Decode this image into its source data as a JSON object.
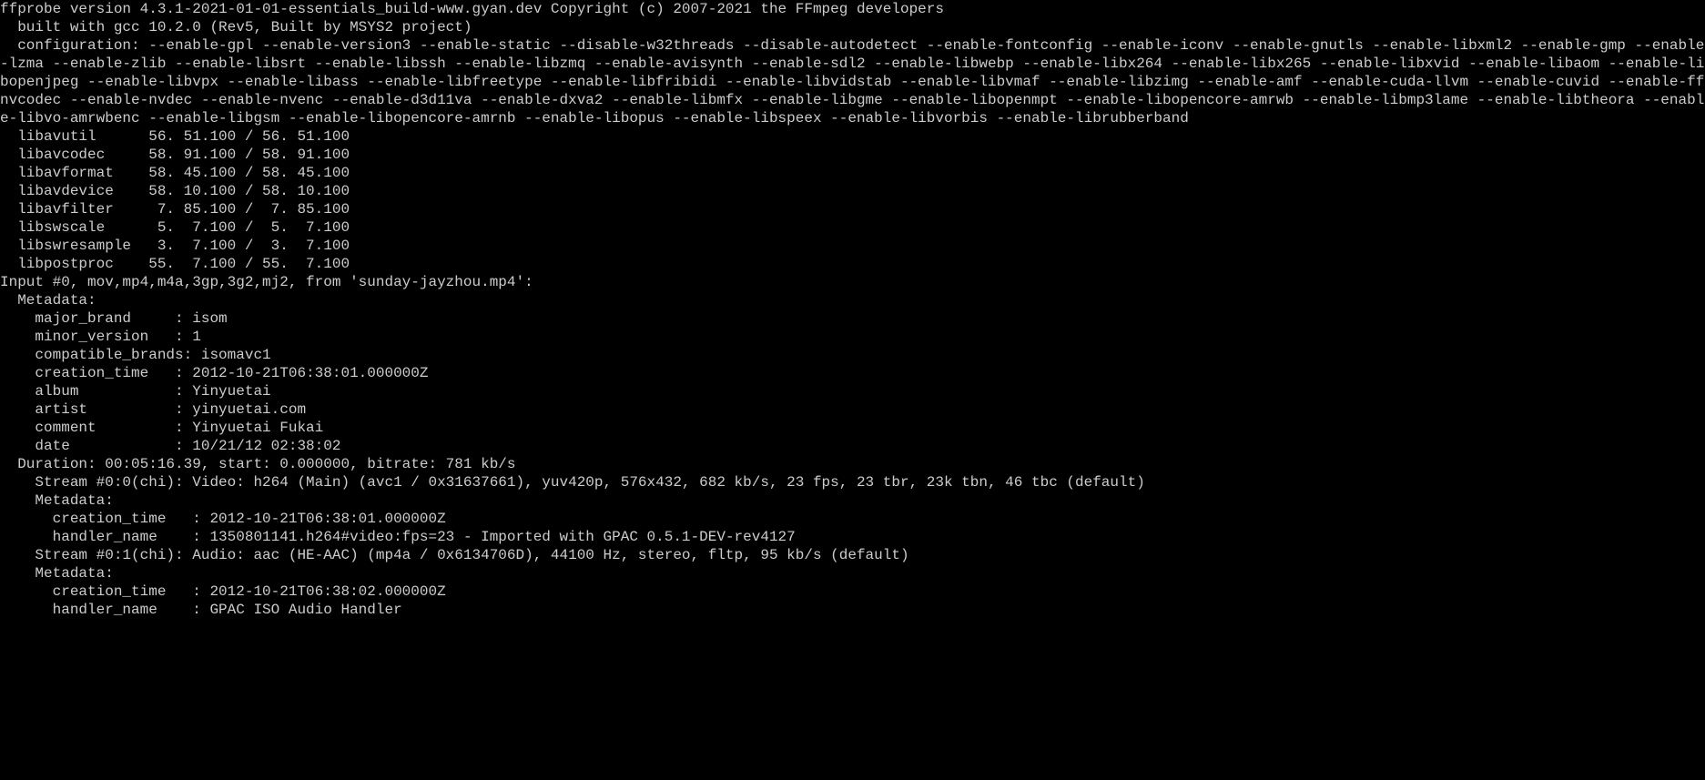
{
  "ffprobe": {
    "header_line": "ffprobe version 4.3.1-2021-01-01-essentials_build-www.gyan.dev Copyright (c) 2007-2021 the FFmpeg developers",
    "built_with": "  built with gcc 10.2.0 (Rev5, Built by MSYS2 project)",
    "configuration": "  configuration: --enable-gpl --enable-version3 --enable-static --disable-w32threads --disable-autodetect --enable-fontconfig --enable-iconv --enable-gnutls --enable-libxml2 --enable-gmp --enable-lzma --enable-zlib --enable-libsrt --enable-libssh --enable-libzmq --enable-avisynth --enable-sdl2 --enable-libwebp --enable-libx264 --enable-libx265 --enable-libxvid --enable-libaom --enable-libopenjpeg --enable-libvpx --enable-libass --enable-libfreetype --enable-libfribidi --enable-libvidstab --enable-libvmaf --enable-libzimg --enable-amf --enable-cuda-llvm --enable-cuvid --enable-ffnvcodec --enable-nvdec --enable-nvenc --enable-d3d11va --enable-dxva2 --enable-libmfx --enable-libgme --enable-libopenmpt --enable-libopencore-amrwb --enable-libmp3lame --enable-libtheora --enable-libvo-amrwbenc --enable-libgsm --enable-libopencore-amrnb --enable-libopus --enable-libspeex --enable-libvorbis --enable-librubberband",
    "libs": {
      "libavutil": "  libavutil      56. 51.100 / 56. 51.100",
      "libavcodec": "  libavcodec     58. 91.100 / 58. 91.100",
      "libavformat": "  libavformat    58. 45.100 / 58. 45.100",
      "libavdevice": "  libavdevice    58. 10.100 / 58. 10.100",
      "libavfilter": "  libavfilter     7. 85.100 /  7. 85.100",
      "libswscale": "  libswscale      5.  7.100 /  5.  7.100",
      "libswresample": "  libswresample   3.  7.100 /  3.  7.100",
      "libpostproc": "  libpostproc    55.  7.100 / 55.  7.100"
    },
    "input_line": "Input #0, mov,mp4,m4a,3gp,3g2,mj2, from 'sunday-jayzhou.mp4':",
    "metadata_label": "  Metadata:",
    "metadata": {
      "major_brand": "    major_brand     : isom",
      "minor_version": "    minor_version   : 1",
      "compatible_brands": "    compatible_brands: isomavc1",
      "creation_time": "    creation_time   : 2012-10-21T06:38:01.000000Z",
      "album": "    album           : Yinyuetai",
      "artist": "    artist          : yinyuetai.com",
      "comment": "    comment         : Yinyuetai Fukai",
      "date": "    date            : 10/21/12 02:38:02"
    },
    "duration_line": "  Duration: 00:05:16.39, start: 0.000000, bitrate: 781 kb/s",
    "stream0": {
      "header": "    Stream #0:0(chi): Video: h264 (Main) (avc1 / 0x31637661), yuv420p, 576x432, 682 kb/s, 23 fps, 23 tbr, 23k tbn, 46 tbc (default)",
      "meta_label": "    Metadata:",
      "creation_time": "      creation_time   : 2012-10-21T06:38:01.000000Z",
      "handler_name": "      handler_name    : 1350801141.h264#video:fps=23 - Imported with GPAC 0.5.1-DEV-rev4127"
    },
    "stream1": {
      "header": "    Stream #0:1(chi): Audio: aac (HE-AAC) (mp4a / 0x6134706D), 44100 Hz, stereo, fltp, 95 kb/s (default)",
      "meta_label": "    Metadata:",
      "creation_time": "      creation_time   : 2012-10-21T06:38:02.000000Z",
      "handler_name": "      handler_name    : GPAC ISO Audio Handler"
    }
  }
}
